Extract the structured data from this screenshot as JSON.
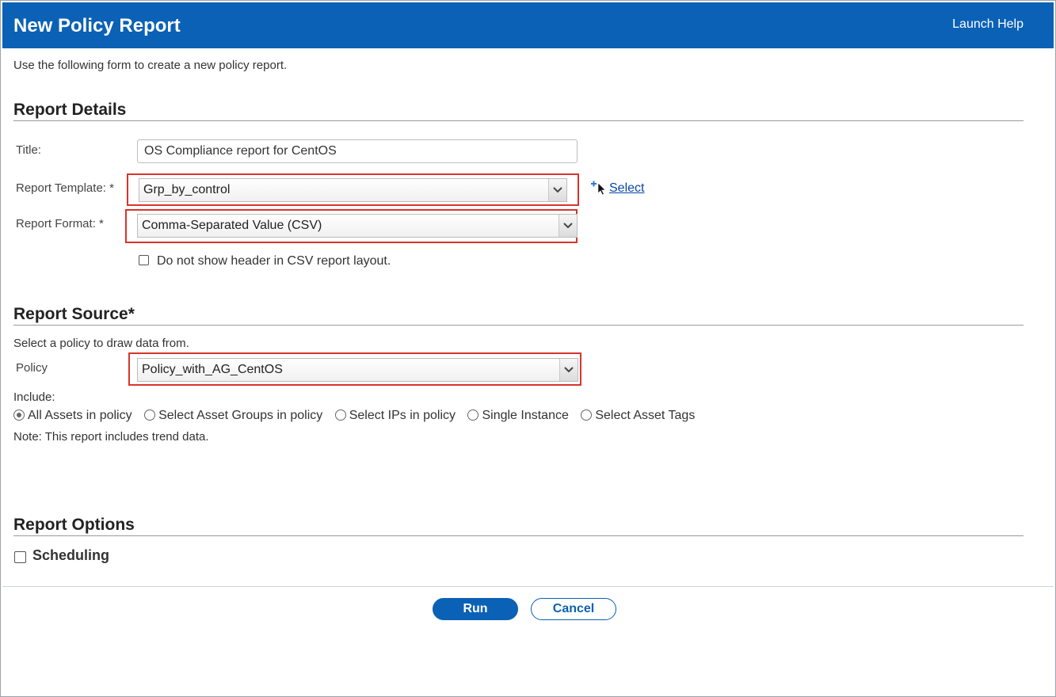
{
  "window": {
    "title": "New Policy Report",
    "help_link": "Launch Help"
  },
  "intro": "Use the following form to create a new policy report.",
  "report_details": {
    "heading": "Report Details",
    "title_label": "Title:",
    "title_value": "OS Compliance report for CentOS",
    "template_label": "Report Template: *",
    "template_value": "Grp_by_control",
    "select_link": "Select",
    "format_label": "Report Format: *",
    "format_value": "Comma-Separated Value (CSV)",
    "csv_header_checkbox": "Do not show header in CSV report layout."
  },
  "report_source": {
    "heading": "Report Source*",
    "description": "Select a policy to draw data from.",
    "policy_label": "Policy",
    "policy_value": "Policy_with_AG_CentOS",
    "include_label": "Include:",
    "options": [
      {
        "label": "All Assets in policy",
        "checked": true
      },
      {
        "label": "Select Asset Groups in policy",
        "checked": false
      },
      {
        "label": "Select IPs in policy",
        "checked": false
      },
      {
        "label": "Single Instance",
        "checked": false
      },
      {
        "label": "Select Asset Tags",
        "checked": false
      }
    ],
    "note": "Note: This report includes trend data."
  },
  "report_options": {
    "heading": "Report Options",
    "scheduling_label": "Scheduling"
  },
  "buttons": {
    "run": "Run",
    "cancel": "Cancel"
  },
  "colors": {
    "header_bg": "#0b61b5",
    "highlight": "#d9342b",
    "link": "#0645ad"
  }
}
